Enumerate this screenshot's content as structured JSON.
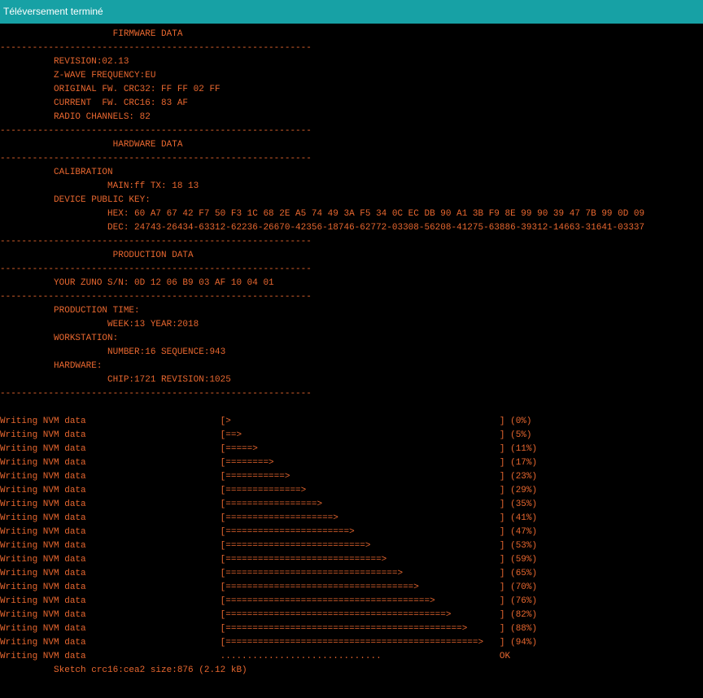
{
  "window": {
    "title": "Téléversement terminé"
  },
  "console": {
    "lines": [
      "----------------------------------------------------------",
      "                     FIRMWARE DATA",
      "----------------------------------------------------------",
      "          REVISION:02.13",
      "          Z-WAVE FREQUENCY:EU",
      "          ORIGINAL FW. CRC32: FF FF 02 FF",
      "          CURRENT  FW. CRC16: 83 AF",
      "          RADIO CHANNELS: 82",
      "----------------------------------------------------------",
      "                     HARDWARE DATA",
      "----------------------------------------------------------",
      "          CALIBRATION",
      "                    MAIN:ff TX: 18 13",
      "          DEVICE PUBLIC KEY:",
      "                    HEX: 60 A7 67 42 F7 50 F3 1C 68 2E A5 74 49 3A F5 34 0C EC DB 90 A1 3B F9 8E 99 90 39 47 7B 99 0D 09",
      "                    DEC: 24743-26434-63312-62236-26670-42356-18746-62772-03308-56208-41275-63886-39312-14663-31641-03337",
      "----------------------------------------------------------",
      "                     PRODUCTION DATA",
      "----------------------------------------------------------",
      "          YOUR ZUNO S/N: 0D 12 06 B9 03 AF 10 04 01",
      "----------------------------------------------------------",
      "          PRODUCTION TIME:",
      "                    WEEK:13 YEAR:2018",
      "          WORKSTATION:",
      "                    NUMBER:16 SEQUENCE:943",
      "          HARDWARE:",
      "                    CHIP:1721 REVISION:1025",
      "----------------------------------------------------------",
      "",
      "Writing NVM data                         [>                                                  ] (0%)",
      "Writing NVM data                         [==>                                                ] (5%)",
      "Writing NVM data                         [=====>                                             ] (11%)",
      "Writing NVM data                         [========>                                          ] (17%)",
      "Writing NVM data                         [===========>                                       ] (23%)",
      "Writing NVM data                         [==============>                                    ] (29%)",
      "Writing NVM data                         [=================>                                 ] (35%)",
      "Writing NVM data                         [====================>                              ] (41%)",
      "Writing NVM data                         [=======================>                           ] (47%)",
      "Writing NVM data                         [==========================>                        ] (53%)",
      "Writing NVM data                         [=============================>                     ] (59%)",
      "Writing NVM data                         [================================>                  ] (65%)",
      "Writing NVM data                         [===================================>               ] (70%)",
      "Writing NVM data                         [======================================>            ] (76%)",
      "Writing NVM data                         [=========================================>         ] (82%)",
      "Writing NVM data                         [============================================>      ] (88%)",
      "Writing NVM data                         [===============================================>   ] (94%)",
      "Writing NVM data                         ..............................                      OK",
      "          Sketch crc16:cea2 size:876 (2.12 kB)"
    ]
  },
  "colors": {
    "text": "#e8672f",
    "background": "#000000",
    "titlebar": "#17a1a5"
  }
}
